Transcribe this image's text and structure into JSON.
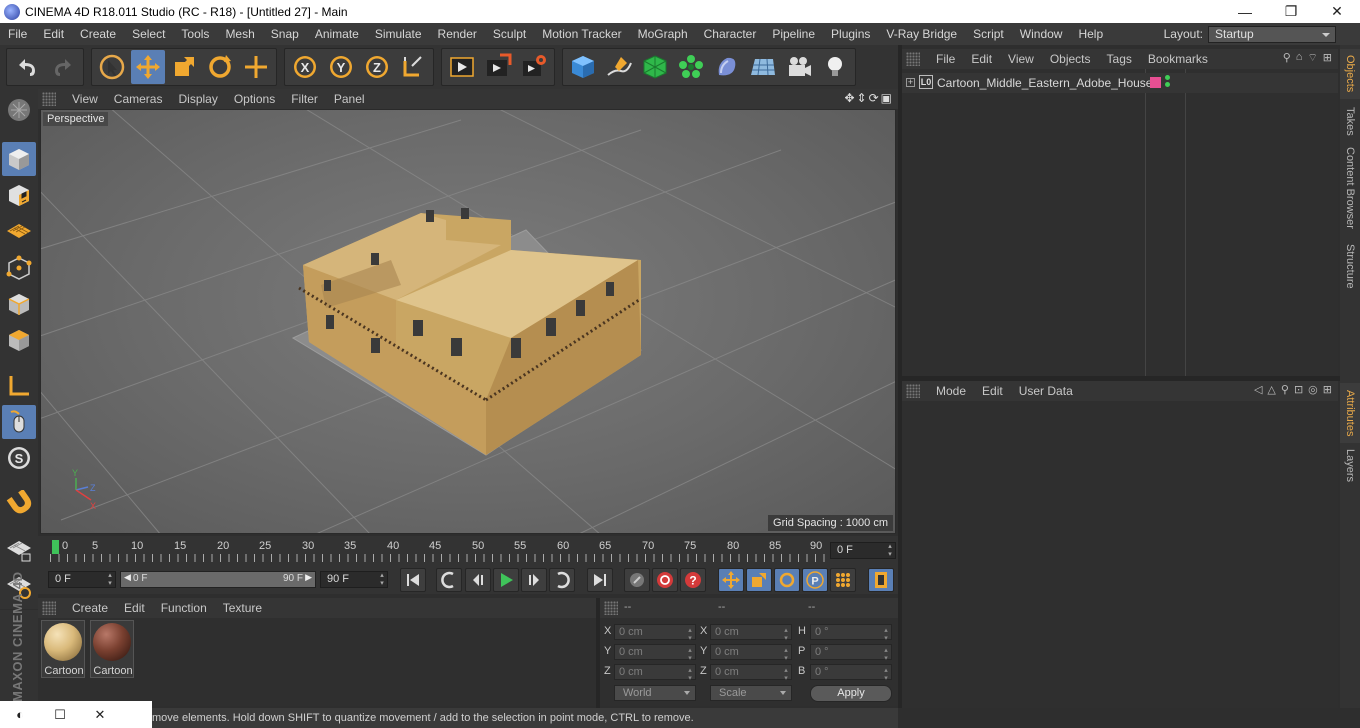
{
  "window": {
    "title": "CINEMA 4D R18.011 Studio (RC - R18) - [Untitled 27] - Main",
    "minimize": "—",
    "restore": "❐",
    "close": "✕"
  },
  "menu": [
    "File",
    "Edit",
    "Create",
    "Select",
    "Tools",
    "Mesh",
    "Snap",
    "Animate",
    "Simulate",
    "Render",
    "Sculpt",
    "Motion Tracker",
    "MoGraph",
    "Character",
    "Pipeline",
    "Plugins",
    "V-Ray Bridge",
    "Script",
    "Window",
    "Help"
  ],
  "layout": {
    "label": "Layout:",
    "value": "Startup"
  },
  "toolbar": {
    "groups": [
      [
        "undo-icon",
        "redo-icon"
      ],
      [
        "select-arrow-icon",
        "move-icon",
        "scale-icon",
        "rotate-icon",
        "live-select-icon"
      ],
      [
        "x-axis-lock-icon",
        "y-axis-lock-icon",
        "z-axis-lock-icon",
        "world-coordinates-icon"
      ],
      [
        "render-view-icon",
        "render-picture-viewer-icon",
        "render-settings-icon"
      ],
      [
        "cube-icon",
        "pen-spline-icon",
        "subdivision-icon",
        "cloner-icon",
        "deformer-icon",
        "floor-icon",
        "camera-icon",
        "light-icon"
      ]
    ],
    "active": [
      "move-icon"
    ]
  },
  "left_tools": {
    "items": [
      "make-editable-icon",
      "model-mode-icon",
      "texture-mode-icon",
      "workplane-icon",
      "points-mode-icon",
      "edges-mode-icon",
      "polygons-mode-icon",
      "axis-mode-icon",
      "tweak-mode-icon",
      "solo-mode-icon",
      "snap-icon",
      "locked-workplane-icon",
      "planar-workplane-icon"
    ],
    "active": [
      "model-mode-icon",
      "tweak-mode-icon"
    ]
  },
  "maxon_logo": {
    "line1": "MAXON",
    "line2": "CINEMA 4D"
  },
  "viewport": {
    "menu": [
      "View",
      "Cameras",
      "Display",
      "Options",
      "Filter",
      "Panel"
    ],
    "label": "Perspective",
    "grid_spacing": "Grid Spacing : 1000 cm",
    "axis_x": "X",
    "axis_y": "Y",
    "axis_z": "Z"
  },
  "timeline": {
    "ticks": [
      "0",
      "5",
      "10",
      "15",
      "20",
      "25",
      "30",
      "35",
      "40",
      "45",
      "50",
      "55",
      "60",
      "65",
      "70",
      "75",
      "80",
      "85",
      "90"
    ],
    "current_frame": "0 F",
    "start_frame": "0 F",
    "range_start": "0 F",
    "range_end": "90 F",
    "end_frame": "90 F"
  },
  "materials": {
    "menu": [
      "Create",
      "Edit",
      "Function",
      "Texture"
    ],
    "items": [
      {
        "name": "Cartoon",
        "color": "#d9b97a"
      },
      {
        "name": "Cartoon",
        "color": "#7a4030"
      }
    ]
  },
  "coordinates": {
    "headers": [
      "--",
      "--",
      "--"
    ],
    "rows": [
      {
        "a_label": "X",
        "a_value": "0 cm",
        "b_label": "X",
        "b_value": "0 cm",
        "c_label": "H",
        "c_value": "0 °"
      },
      {
        "a_label": "Y",
        "a_value": "0 cm",
        "b_label": "Y",
        "b_value": "0 cm",
        "c_label": "P",
        "c_value": "0 °"
      },
      {
        "a_label": "Z",
        "a_value": "0 cm",
        "b_label": "Z",
        "b_value": "0 cm",
        "c_label": "B",
        "c_value": "0 °"
      }
    ],
    "mode_dropdown": "World",
    "size_dropdown": "Scale",
    "apply_label": "Apply"
  },
  "status": "move elements. Hold down SHIFT to quantize movement / add to the selection in point mode, CTRL to remove.",
  "objects_panel": {
    "menu": [
      "File",
      "Edit",
      "View",
      "Objects",
      "Tags",
      "Bookmarks"
    ],
    "object_name": "Cartoon_Middle_Eastern_Adobe_House",
    "layer_badge": "L0"
  },
  "attributes_panel": {
    "menu": [
      "Mode",
      "Edit",
      "User Data"
    ]
  },
  "right_tabs": [
    "Objects",
    "Takes",
    "Content Browser",
    "Structure",
    "Attributes",
    "Layers"
  ],
  "colors": {
    "accent_orange": "#e8a94a",
    "active_blue": "#5a7fb5",
    "playhead_green": "#3fc35a",
    "tag_pink": "#e84f93"
  }
}
